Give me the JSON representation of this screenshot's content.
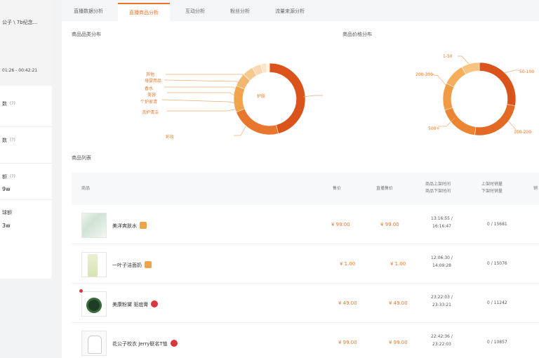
{
  "left_panel": {
    "title_fragment": "公子 \\ 7b纪念...",
    "time_range": "01:26 - 00:42:21",
    "metrics": [
      {
        "label": "数",
        "hint": "(?)",
        "value": ""
      },
      {
        "label": "数",
        "hint": "(?)",
        "value": ""
      },
      {
        "label": "额",
        "hint": "(?)",
        "value": "9w"
      },
      {
        "label": "球额",
        "hint": "",
        "value": "3w"
      }
    ]
  },
  "tabs": [
    "直播数据分析",
    "直播商品分析",
    "互动分析",
    "粉丝分析",
    "流量来源分析"
  ],
  "sections": {
    "category": "商品品类分布",
    "price": "商品价格分布",
    "list": "商品列表"
  },
  "category_chart": {
    "labels": [
      "护肤",
      "彩妆",
      "洗护清洁",
      "个护家清",
      "美容",
      "香水",
      "母婴用品",
      "其他"
    ],
    "colors": [
      "#d9531a",
      "#e8772d",
      "#f0a34a",
      "#f3b870",
      "#f6c98f",
      "#f9dab0",
      "#fbe6c9",
      "#fdf2e2"
    ]
  },
  "price_chart": {
    "labels": [
      "50-100",
      "100-200",
      "200-300",
      "300-500",
      "500+",
      "1-50"
    ],
    "colors": [
      "#d9531a",
      "#e26a24",
      "#eb8532",
      "#f09a43",
      "#f4ae5c",
      "#f7c37f"
    ]
  },
  "table": {
    "headers": {
      "product": "商品",
      "price": "售价",
      "live_price": "直播售价",
      "time": "商品上架时间\n商品下架时间",
      "ratio": "上架时销量\n下架时销量",
      "more": "销"
    },
    "rows": [
      {
        "name": "美洋爽肤水",
        "badge": "orange",
        "price": "¥ 99.00",
        "live_price": "¥ 99.00",
        "time_on": "13:16:55 /",
        "time_off": "16:16:47",
        "ratio": "0 / 15681"
      },
      {
        "name": "一叶子洁面奶",
        "badge": "orange",
        "price": "¥ 1.00",
        "live_price": "¥ 1.00",
        "time_on": "12:06:30 /",
        "time_off": "14:09:28",
        "ratio": "0 / 15076"
      },
      {
        "name": "美康粉黛 驱痘膏",
        "badge": "red",
        "price": "¥ 49.00",
        "live_price": "¥ 49.00",
        "time_on": "23:22:03 /",
        "time_off": "23:33:21",
        "ratio": "0 / 11242"
      },
      {
        "name": "花公子校衣 Jerry联名T恤",
        "badge": "red",
        "price": "¥ 99.00",
        "live_price": "¥ 99.00",
        "time_on": "22:42:36 /",
        "time_off": "23:22:03",
        "ratio": "0 / 10857"
      }
    ]
  }
}
